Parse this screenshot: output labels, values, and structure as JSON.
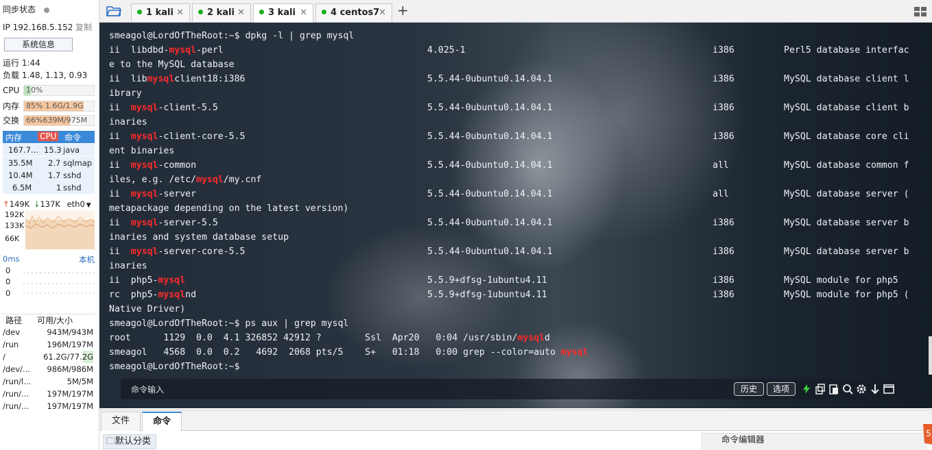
{
  "sidebar": {
    "sync_label": "同步状态",
    "ip": "IP 192.168.5.152",
    "copy": "复制",
    "sysinfo": "系统信息",
    "uptime": "运行 1:44",
    "load": "负载 1.48, 1.13, 0.93",
    "cpu": {
      "label": "CPU",
      "text": "10%",
      "pct": 10
    },
    "mem": {
      "label": "内存",
      "text": "85%  1.6G/1.9G",
      "pct": 85
    },
    "swap": {
      "label": "交换",
      "text": "66%639M/975M",
      "pct": 66
    },
    "proc_headers": [
      "内存",
      "CPU",
      "命令"
    ],
    "procs": [
      {
        "mem": "167.7...",
        "cpu": "15.3",
        "cmd": "java"
      },
      {
        "mem": "35.5M",
        "cpu": "2.7",
        "cmd": "sqlmap"
      },
      {
        "mem": "10.4M",
        "cpu": "1.7",
        "cmd": "sshd"
      },
      {
        "mem": "6.5M",
        "cpu": "1",
        "cmd": "sshd"
      }
    ],
    "net": {
      "up": "149K",
      "down": "137K",
      "iface": "eth0",
      "ticks": [
        "192K",
        "133K",
        "66K"
      ]
    },
    "ping": {
      "label": "0ms",
      "host": "本机",
      "values": [
        "0",
        "0",
        "0"
      ]
    },
    "disk_headers": [
      "路径",
      "可用/大小"
    ],
    "disks": [
      {
        "path": "/dev",
        "size": "943M/943M"
      },
      {
        "path": "/run",
        "size": "196M/197M"
      },
      {
        "path": "/",
        "size": "61.2G/77.2G"
      },
      {
        "path": "/dev/...",
        "size": "986M/986M"
      },
      {
        "path": "/run/l...",
        "size": "5M/5M"
      },
      {
        "path": "/run/...",
        "size": "197M/197M"
      },
      {
        "path": "/run/...",
        "size": "197M/197M"
      }
    ]
  },
  "tabs": [
    {
      "label": "1 kali"
    },
    {
      "label": "2 kali"
    },
    {
      "label": "3 kali"
    },
    {
      "label": "4 centos7"
    }
  ],
  "add_tab": "+",
  "terminal": {
    "lines": [
      {
        "a": "smeagol@LordOfTheRoot:~$ dpkg -l | grep mysql"
      },
      {
        "a": "ii  libdbd-",
        "h": "mysql",
        "b": "-perl",
        "v": "4.025-1",
        "arch": "i386",
        "d": "Perl5 database interfac"
      },
      {
        "a": "e to the MySQL database"
      },
      {
        "a": "ii  lib",
        "h": "mysql",
        "b": "client18:i386",
        "v": "5.5.44-0ubuntu0.14.04.1",
        "arch": "i386",
        "d": "MySQL database client l"
      },
      {
        "a": "ibrary"
      },
      {
        "a": "ii  ",
        "h": "mysql",
        "b": "-client-5.5",
        "v": "5.5.44-0ubuntu0.14.04.1",
        "arch": "i386",
        "d": "MySQL database client b"
      },
      {
        "a": "inaries"
      },
      {
        "a": "ii  ",
        "h": "mysql",
        "b": "-client-core-5.5",
        "v": "5.5.44-0ubuntu0.14.04.1",
        "arch": "i386",
        "d": "MySQL database core cli"
      },
      {
        "a": "ent binaries"
      },
      {
        "a": "ii  ",
        "h": "mysql",
        "b": "-common",
        "v": "5.5.44-0ubuntu0.14.04.1",
        "arch": "all",
        "d": "MySQL database common f"
      },
      {
        "a": "iles, e.g. /etc/",
        "h": "mysql",
        "b": "/my.cnf"
      },
      {
        "a": "ii  ",
        "h": "mysql",
        "b": "-server",
        "v": "5.5.44-0ubuntu0.14.04.1",
        "arch": "all",
        "d": "MySQL database server ("
      },
      {
        "a": "metapackage depending on the latest version)"
      },
      {
        "a": "ii  ",
        "h": "mysql",
        "b": "-server-5.5",
        "v": "5.5.44-0ubuntu0.14.04.1",
        "arch": "i386",
        "d": "MySQL database server b"
      },
      {
        "a": "inaries and system database setup"
      },
      {
        "a": "ii  ",
        "h": "mysql",
        "b": "-server-core-5.5",
        "v": "5.5.44-0ubuntu0.14.04.1",
        "arch": "i386",
        "d": "MySQL database server b"
      },
      {
        "a": "inaries"
      },
      {
        "a": "ii  php5-",
        "h": "mysql",
        "v": "5.5.9+dfsg-1ubuntu4.11",
        "arch": "i386",
        "d": "MySQL module for php5"
      },
      {
        "a": "rc  php5-",
        "h": "mysql",
        "b": "nd",
        "v": "5.5.9+dfsg-1ubuntu4.11",
        "arch": "i386",
        "d": "MySQL module for php5 ("
      },
      {
        "a": "Native Driver)"
      },
      {
        "a": "smeagol@LordOfTheRoot:~$ ps aux | grep mysql"
      },
      {
        "a": "root      1129  0.0  4.1 326852 42912 ?        Ssl  Apr20   0:04 /usr/sbin/",
        "h": "mysql",
        "b": "d"
      },
      {
        "a": "smeagol   4568  0.0  0.2   4692  2068 pts/5    S+   01:18   0:00 grep --color=auto ",
        "h": "mysql"
      },
      {
        "a": "smeagol@LordOfTheRoot:~$"
      }
    ]
  },
  "cmdbar": {
    "placeholder": "命令输入",
    "history": "历史",
    "options": "选项"
  },
  "bottom": {
    "files_tab": "文件",
    "commands_tab": "命令",
    "category": "默认分类",
    "editor": "命令编辑器"
  },
  "colors": {
    "accent": "#3b8ad9",
    "highlight": "#ff2a2a",
    "active_dot": "#1aad19"
  }
}
